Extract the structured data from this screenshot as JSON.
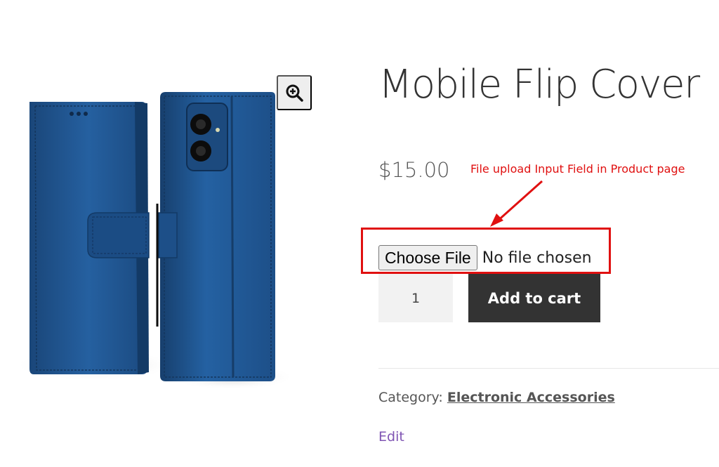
{
  "product": {
    "title": "Mobile Flip Cover",
    "price": "$15.00",
    "image_alt": "blue-leather-flip-cover-phone-case"
  },
  "gallery": {
    "zoom_icon": "magnifier-plus-icon"
  },
  "file_upload": {
    "button_label": "Choose File",
    "status_text": "No file chosen"
  },
  "cart": {
    "quantity": "1",
    "add_to_cart_label": "Add to cart"
  },
  "meta": {
    "category_label": "Category:",
    "category_value": "Electronic Accessories",
    "edit_label": "Edit"
  },
  "annotation": {
    "text": "File upload Input Field in Product page",
    "color": "#e01010"
  },
  "colors": {
    "cover_blue": "#1f4f86",
    "button_dark": "#333333",
    "edit_link": "#7f54b3"
  }
}
